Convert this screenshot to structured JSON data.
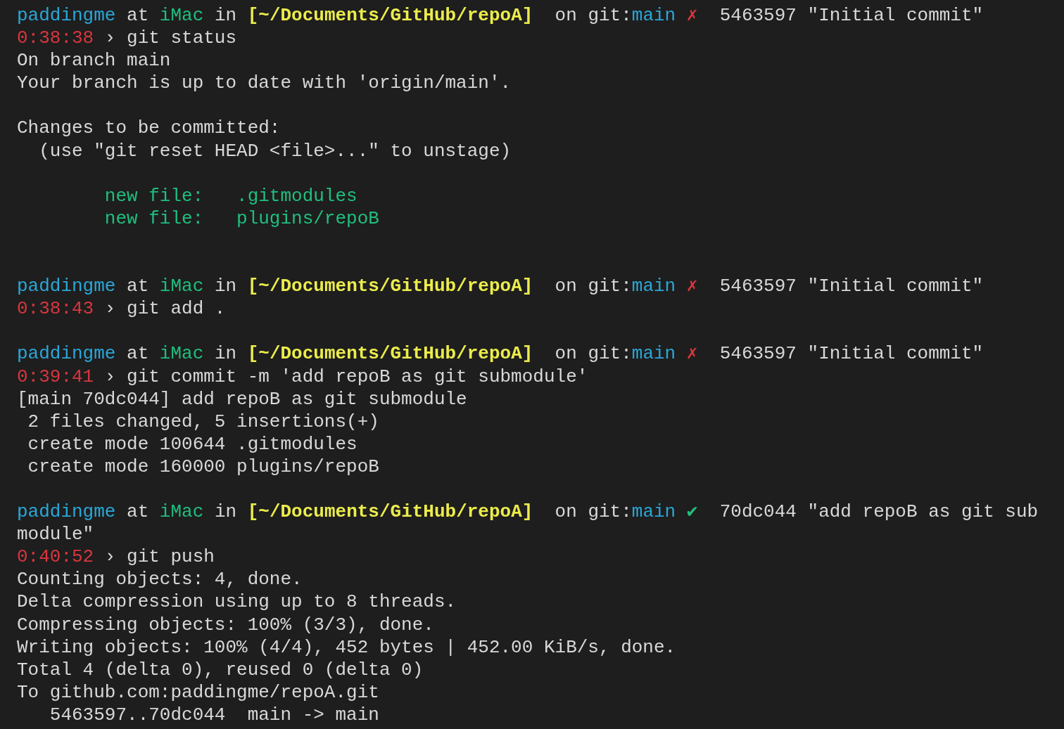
{
  "lines": [
    {
      "kind": "text",
      "segments": [
        {
          "kind": "user",
          "text": "paddingme"
        },
        {
          "kind": "plain",
          "text": " at "
        },
        {
          "kind": "host",
          "text": "iMac"
        },
        {
          "kind": "plain",
          "text": " in "
        },
        {
          "kind": "path",
          "text": "[~/Documents/GitHub/repoA]"
        },
        {
          "kind": "plain",
          "text": "  on git:"
        },
        {
          "kind": "branch",
          "text": "main"
        },
        {
          "kind": "dirty",
          "text": " ✗"
        },
        {
          "kind": "plain",
          "text": "  5463597 \"Initial commit\""
        }
      ]
    },
    {
      "kind": "text",
      "segments": [
        {
          "kind": "time",
          "text": "0:38:38"
        },
        {
          "kind": "plain",
          "text": " › git status"
        }
      ]
    },
    {
      "kind": "text",
      "segments": [
        {
          "kind": "plain",
          "text": "On branch main"
        }
      ]
    },
    {
      "kind": "text",
      "segments": [
        {
          "kind": "plain",
          "text": "Your branch is up to date with 'origin/main'."
        }
      ]
    },
    {
      "kind": "blank"
    },
    {
      "kind": "text",
      "segments": [
        {
          "kind": "plain",
          "text": "Changes to be committed:"
        }
      ]
    },
    {
      "kind": "text",
      "segments": [
        {
          "kind": "plain",
          "text": "  (use \"git reset HEAD <file>...\" to unstage)"
        }
      ]
    },
    {
      "kind": "blank"
    },
    {
      "kind": "indented",
      "segments": [
        {
          "kind": "staged",
          "text": "new file:   .gitmodules"
        }
      ]
    },
    {
      "kind": "indented",
      "segments": [
        {
          "kind": "staged",
          "text": "new file:   plugins/repoB"
        }
      ]
    },
    {
      "kind": "blank"
    },
    {
      "kind": "blank"
    },
    {
      "kind": "text",
      "segments": [
        {
          "kind": "user",
          "text": "paddingme"
        },
        {
          "kind": "plain",
          "text": " at "
        },
        {
          "kind": "host",
          "text": "iMac"
        },
        {
          "kind": "plain",
          "text": " in "
        },
        {
          "kind": "path",
          "text": "[~/Documents/GitHub/repoA]"
        },
        {
          "kind": "plain",
          "text": "  on git:"
        },
        {
          "kind": "branch",
          "text": "main"
        },
        {
          "kind": "dirty",
          "text": " ✗"
        },
        {
          "kind": "plain",
          "text": "  5463597 \"Initial commit\""
        }
      ]
    },
    {
      "kind": "text",
      "segments": [
        {
          "kind": "time",
          "text": "0:38:43"
        },
        {
          "kind": "plain",
          "text": " › git add ."
        }
      ]
    },
    {
      "kind": "blank"
    },
    {
      "kind": "text",
      "segments": [
        {
          "kind": "user",
          "text": "paddingme"
        },
        {
          "kind": "plain",
          "text": " at "
        },
        {
          "kind": "host",
          "text": "iMac"
        },
        {
          "kind": "plain",
          "text": " in "
        },
        {
          "kind": "path",
          "text": "[~/Documents/GitHub/repoA]"
        },
        {
          "kind": "plain",
          "text": "  on git:"
        },
        {
          "kind": "branch",
          "text": "main"
        },
        {
          "kind": "dirty",
          "text": " ✗"
        },
        {
          "kind": "plain",
          "text": "  5463597 \"Initial commit\""
        }
      ]
    },
    {
      "kind": "text",
      "segments": [
        {
          "kind": "time",
          "text": "0:39:41"
        },
        {
          "kind": "plain",
          "text": " › git commit -m 'add repoB as git submodule'"
        }
      ]
    },
    {
      "kind": "text",
      "segments": [
        {
          "kind": "plain",
          "text": "[main 70dc044] add repoB as git submodule"
        }
      ]
    },
    {
      "kind": "text",
      "segments": [
        {
          "kind": "plain",
          "text": " 2 files changed, 5 insertions(+)"
        }
      ]
    },
    {
      "kind": "text",
      "segments": [
        {
          "kind": "plain",
          "text": " create mode 100644 .gitmodules"
        }
      ]
    },
    {
      "kind": "text",
      "segments": [
        {
          "kind": "plain",
          "text": " create mode 160000 plugins/repoB"
        }
      ]
    },
    {
      "kind": "blank"
    },
    {
      "kind": "text",
      "segments": [
        {
          "kind": "user",
          "text": "paddingme"
        },
        {
          "kind": "plain",
          "text": " at "
        },
        {
          "kind": "host",
          "text": "iMac"
        },
        {
          "kind": "plain",
          "text": " in "
        },
        {
          "kind": "path",
          "text": "[~/Documents/GitHub/repoA]"
        },
        {
          "kind": "plain",
          "text": "  on git:"
        },
        {
          "kind": "branch",
          "text": "main"
        },
        {
          "kind": "clean",
          "text": " ✔"
        },
        {
          "kind": "plain",
          "text": "  70dc044 \"add repoB as git sub"
        }
      ]
    },
    {
      "kind": "text",
      "segments": [
        {
          "kind": "plain",
          "text": "module\""
        }
      ]
    },
    {
      "kind": "text",
      "segments": [
        {
          "kind": "time",
          "text": "0:40:52"
        },
        {
          "kind": "plain",
          "text": " › git push"
        }
      ]
    },
    {
      "kind": "text",
      "segments": [
        {
          "kind": "plain",
          "text": "Counting objects: 4, done."
        }
      ]
    },
    {
      "kind": "text",
      "segments": [
        {
          "kind": "plain",
          "text": "Delta compression using up to 8 threads."
        }
      ]
    },
    {
      "kind": "text",
      "segments": [
        {
          "kind": "plain",
          "text": "Compressing objects: 100% (3/3), done."
        }
      ]
    },
    {
      "kind": "text",
      "segments": [
        {
          "kind": "plain",
          "text": "Writing objects: 100% (4/4), 452 bytes | 452.00 KiB/s, done."
        }
      ]
    },
    {
      "kind": "text",
      "segments": [
        {
          "kind": "plain",
          "text": "Total 4 (delta 0), reused 0 (delta 0)"
        }
      ]
    },
    {
      "kind": "text",
      "segments": [
        {
          "kind": "plain",
          "text": "To github.com:paddingme/repoA.git"
        }
      ]
    },
    {
      "kind": "text",
      "segments": [
        {
          "kind": "plain",
          "text": "   5463597..70dc044  main -> main"
        }
      ]
    }
  ]
}
